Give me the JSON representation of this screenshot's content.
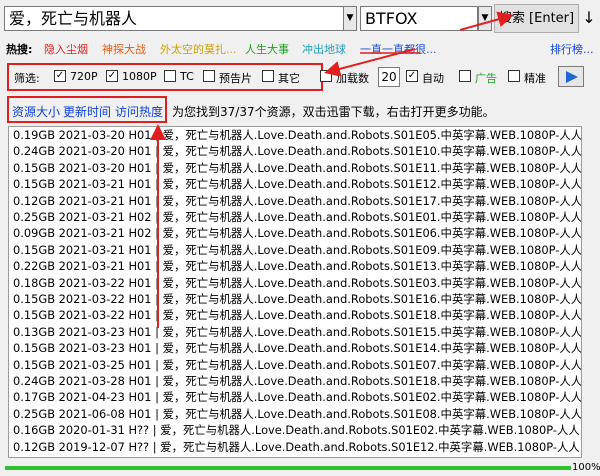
{
  "search": {
    "query": "爱，死亡与机器人",
    "engine": "BTFOX",
    "button_label": "搜索 [Enter]",
    "down_label": "↓"
  },
  "hot": {
    "label": "热搜:",
    "items": [
      {
        "text": "隐入尘烟",
        "color": "#e02020"
      },
      {
        "text": "神探大战",
        "color": "#e06010"
      },
      {
        "text": "外太空的莫扎...",
        "color": "#d0a000"
      },
      {
        "text": "人生大事",
        "color": "#20a020"
      },
      {
        "text": "冲出地球",
        "color": "#20a0c0"
      },
      {
        "text": "一直一直都很...",
        "color": "#2050d0"
      }
    ],
    "ranking_label": "排行榜..."
  },
  "filter": {
    "label": "筛选:",
    "options": [
      {
        "label": "720P",
        "checked": true
      },
      {
        "label": "1080P",
        "checked": true
      },
      {
        "label": "TC",
        "checked": false
      },
      {
        "label": "预告片",
        "checked": false
      },
      {
        "label": "其它",
        "checked": false
      }
    ],
    "load_count_label": "加载数",
    "load_count_checked": false,
    "load_count_value": "20",
    "auto_label": "自动",
    "auto_checked": true,
    "ad_label": "广告",
    "ad_checked": false,
    "precise_label": "精准",
    "precise_checked": false,
    "play_icon": "play-icon"
  },
  "sort": {
    "by_size": "资源大小",
    "by_time": "更新时间",
    "by_heat": "访问热度",
    "info": "为您找到37/37个资源，双击迅雷下载，右击打开更多功能。"
  },
  "results": [
    "0.19GB 2021-03-20 H01 | 爱，死亡与机器人.Love.Death.and.Robots.S01E05.中英字幕.WEB.1080P-人人",
    "0.24GB 2021-03-20 H01 | 爱，死亡与机器人.Love.Death.and.Robots.S01E10.中英字幕.WEB.1080P-人人",
    "0.15GB 2021-03-20 H01 | 爱，死亡与机器人.Love.Death.and.Robots.S01E11.中英字幕.WEB.1080P-人人",
    "0.15GB 2021-03-21 H01 | 爱，死亡与机器人.Love.Death.and.Robots.S01E12.中英字幕.WEB.1080P-人人",
    "0.12GB 2021-03-21 H01 | 爱，死亡与机器人.Love.Death.and.Robots.S01E17.中英字幕.WEB.1080P-人人",
    "0.25GB 2021-03-21 H02 | 爱，死亡与机器人.Love.Death.and.Robots.S01E01.中英字幕.WEB.1080P-人人",
    "0.09GB 2021-03-21 H02 | 爱，死亡与机器人.Love.Death.and.Robots.S01E06.中英字幕.WEB.1080P-人人",
    "0.15GB 2021-03-21 H01 | 爱，死亡与机器人.Love.Death.and.Robots.S01E09.中英字幕.WEB.1080P-人人",
    "0.22GB 2021-03-21 H01 | 爱，死亡与机器人.Love.Death.and.Robots.S01E13.中英字幕.WEB.1080P-人人",
    "0.18GB 2021-03-22 H01 | 爱，死亡与机器人.Love.Death.and.Robots.S01E03.中英字幕.WEB.1080P-人人",
    "0.15GB 2021-03-22 H01 | 爱，死亡与机器人.Love.Death.and.Robots.S01E16.中英字幕.WEB.1080P-人人",
    "0.15GB 2021-03-22 H01 | 爱，死亡与机器人.Love.Death.and.Robots.S01E18.中英字幕.WEB.1080P-人人",
    "0.13GB 2021-03-23 H01 | 爱，死亡与机器人.Love.Death.and.Robots.S01E15.中英字幕.WEB.1080P-人人",
    "0.15GB 2021-03-23 H01 | 爱，死亡与机器人.Love.Death.and.Robots.S01E14.中英字幕.WEB.1080P-人人",
    "0.15GB 2021-03-25 H01 | 爱，死亡与机器人.Love.Death.and.Robots.S01E07.中英字幕.WEB.1080P-人人",
    "0.24GB 2021-03-28 H01 | 爱，死亡与机器人.Love.Death.and.Robots.S01E18.中英字幕.WEB.1080P-人人",
    "0.17GB 2021-04-23 H01 | 爱，死亡与机器人.Love.Death.and.Robots.S01E02.中英字幕.WEB.1080P-人人",
    "0.25GB 2021-06-08 H01 | 爱，死亡与机器人.Love.Death.and.Robots.S01E08.中英字幕.WEB.1080P-人人",
    "0.16GB 2020-01-31 H?? | 爱，死亡与机器人.Love.Death.and.Robots.S01E02.中英字幕.WEB.1080P-人人",
    "0.12GB 2019-12-07 H?? | 爱，死亡与机器人.Love.Death.and.Robots.S01E12.中英字幕.WEB.1080P-人人"
  ],
  "status": {
    "progress": 1.0,
    "percent_label": "100%"
  },
  "colors": {
    "accent_red": "#e02020",
    "link_blue": "#0b3fd6",
    "progress_green": "#30c030"
  }
}
